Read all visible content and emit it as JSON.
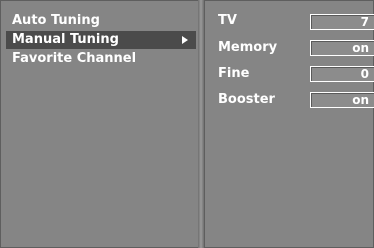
{
  "menu": {
    "items": [
      {
        "label": "Auto Tuning"
      },
      {
        "label": "Manual Tuning",
        "selected": true
      },
      {
        "label": "Favorite Channel"
      }
    ]
  },
  "settings": [
    {
      "label": "TV",
      "value": "7"
    },
    {
      "label": "Memory",
      "value": "on"
    },
    {
      "label": "Fine",
      "value": "0"
    },
    {
      "label": "Booster",
      "value": "on"
    }
  ],
  "colors": {
    "panel": "#858585",
    "selected_row": "#4b4b4b",
    "text": "#ffffff"
  },
  "icons": {
    "submenu_arrow": "right-triangle-icon"
  }
}
